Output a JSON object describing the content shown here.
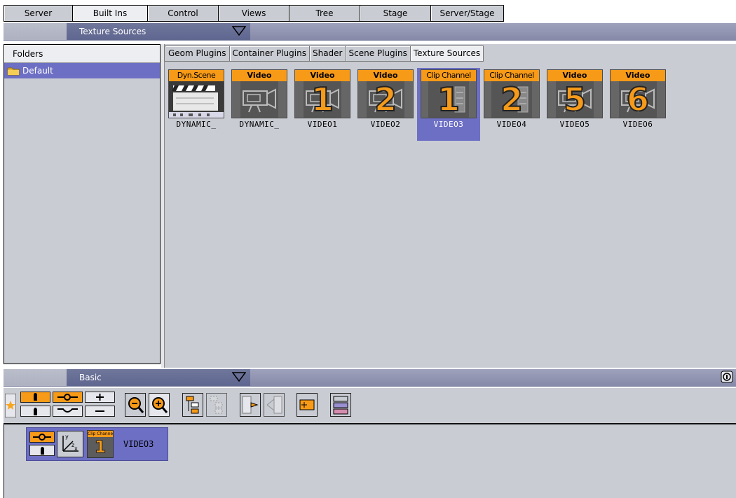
{
  "top_tabs": [
    {
      "label": "Server",
      "width": 98
    },
    {
      "label": "Built Ins",
      "width": 107,
      "active": true
    },
    {
      "label": "Control",
      "width": 101
    },
    {
      "label": "Views",
      "width": 101
    },
    {
      "label": "Tree",
      "width": 101
    },
    {
      "label": "Stage",
      "width": 101
    },
    {
      "label": "Server/Stage",
      "width": 105
    }
  ],
  "top_panel": {
    "title": "Texture Sources"
  },
  "folders": {
    "header": "Folders",
    "items": [
      {
        "label": "Default",
        "selected": true
      }
    ]
  },
  "plugin_tabs": [
    {
      "label": "Geom Plugins"
    },
    {
      "label": "Container Plugins"
    },
    {
      "label": "Shader"
    },
    {
      "label": "Scene Plugins"
    },
    {
      "label": "Texture Sources",
      "active": true
    }
  ],
  "tiles": [
    {
      "badge": "Dyn.Scene",
      "number": "",
      "art": "clapper",
      "name": "DYNAMIC_"
    },
    {
      "badge": "Video",
      "number": "",
      "art": "camera",
      "name": "DYNAMIC_"
    },
    {
      "badge": "Video",
      "number": "1",
      "art": "camera",
      "name": "VIDEO1"
    },
    {
      "badge": "Video",
      "number": "2",
      "art": "camera",
      "name": "VIDEO2"
    },
    {
      "badge": "Clip Channel",
      "number": "1",
      "art": "film",
      "name": "VIDEO3",
      "selected": true
    },
    {
      "badge": "Clip Channel",
      "number": "2",
      "art": "film",
      "name": "VIDEO4"
    },
    {
      "badge": "Video",
      "number": "5",
      "art": "camera",
      "name": "VIDEO5"
    },
    {
      "badge": "Video",
      "number": "6",
      "art": "camera",
      "name": "VIDEO6"
    }
  ],
  "bottom_panel": {
    "title": "Basic"
  },
  "scene": {
    "item_name": "VIDEO3",
    "badge": "Clip Channel",
    "number": "1"
  },
  "colors": {
    "accent_orange": "#f79a17",
    "selection_purple": "#6d6fc4",
    "panel_gray": "#c9ccd3"
  }
}
